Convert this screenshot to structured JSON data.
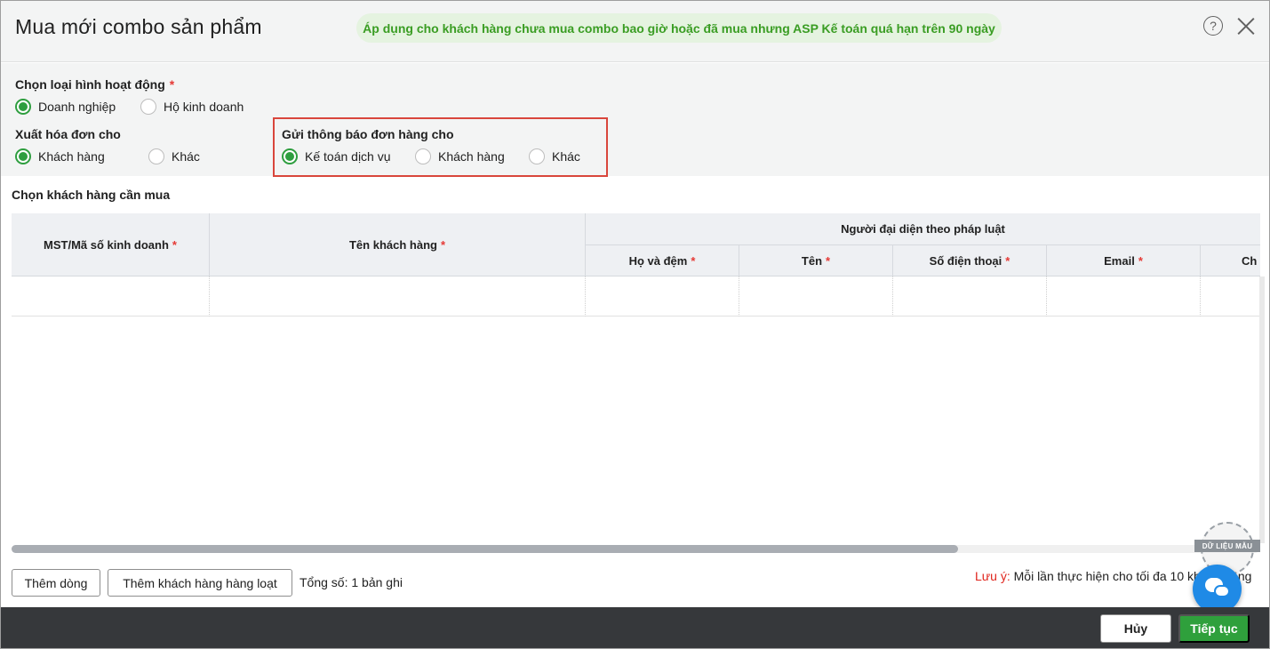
{
  "dialog": {
    "title": "Mua mới combo sản phẩm",
    "banner": "Áp dụng cho khách hàng chưa mua combo bao giờ hoặc đã mua nhưng ASP Kế toán quá hạn trên 90 ngày",
    "help_glyph": "?",
    "icons": {
      "help": "help-icon",
      "close": "close-icon",
      "chat": "chat-icon"
    }
  },
  "options": {
    "business_type": {
      "label": "Chọn loại hình hoạt động",
      "required_mark": "*",
      "choices": [
        "Doanh nghiệp",
        "Hộ kinh doanh"
      ],
      "selected": "Doanh nghiệp"
    },
    "invoice_for": {
      "label": "Xuất hóa đơn cho",
      "choices": [
        "Khách hàng",
        "Khác"
      ],
      "selected": "Khách hàng"
    },
    "notify_to": {
      "label": "Gửi thông báo đơn hàng cho",
      "choices": [
        "Kế toán dịch vụ",
        "Khách hàng",
        "Khác"
      ],
      "selected": "Kế toán dịch vụ"
    }
  },
  "customers": {
    "section_title": "Chọn khách hàng cần mua",
    "columns": {
      "tax_code": "MST/Mã số kinh doanh",
      "name": "Tên khách hàng",
      "legal_rep_group": "Người đại diện theo pháp luật",
      "last_middle": "Họ và đệm",
      "first_name": "Tên",
      "phone": "Số điện thoại",
      "email": "Email",
      "partial": "Ch"
    },
    "required_mark": "*"
  },
  "actions": {
    "add_row": "Thêm dòng",
    "add_bulk": "Thêm khách hàng hàng loạt",
    "total": "Tổng số: 1 bản ghi",
    "note_label": "Lưu ý:",
    "note_text": " Mỗi lần thực hiện cho tối đa 10 khách hàng"
  },
  "footer": {
    "cancel": "Hủy",
    "next": "Tiếp tục"
  },
  "watermark": "DỮ LIỆU MẪU",
  "colors": {
    "accent": "#2e9e3f",
    "banner_text": "#3a9d23",
    "highlight_border": "#d9463c",
    "note_label": "#e0241c",
    "footer_bg": "#36383b",
    "chat": "#1f8ae6"
  }
}
